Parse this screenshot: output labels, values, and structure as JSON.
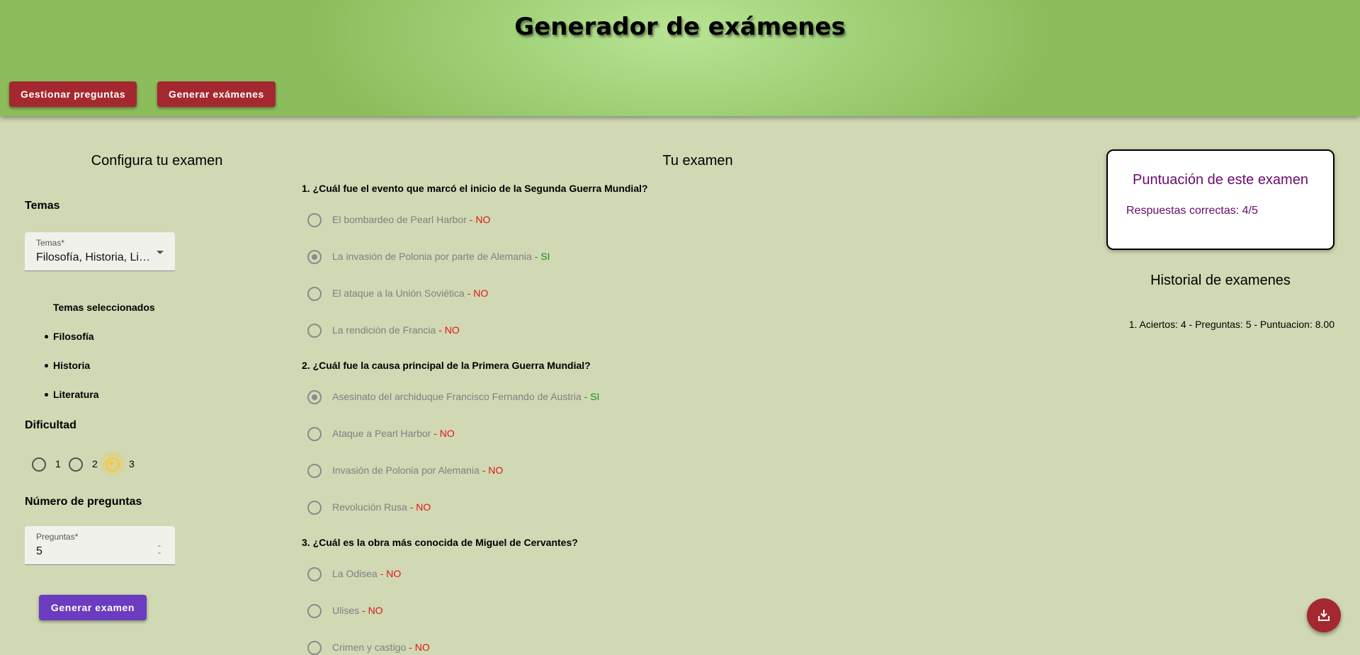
{
  "header": {
    "title": "Generador de exámenes",
    "nav": [
      "Gestionar preguntas",
      "Generar exámenes"
    ]
  },
  "config": {
    "title": "Configura tu examen",
    "topics_heading": "Temas",
    "topics_select": {
      "label": "Temas*",
      "value": "Filosofía, Historia, Li…"
    },
    "selected_heading": "Temas seleccionados",
    "selected_topics": [
      "Filosofía",
      "Historia",
      "Literatura"
    ],
    "difficulty_heading": "Dificultad",
    "difficulty_options": [
      "1",
      "2",
      "3"
    ],
    "difficulty_selected": "3",
    "questions_heading": "Número de preguntas",
    "questions_field": {
      "label": "Preguntas*",
      "value": "5"
    },
    "generate_label": "Generar examen"
  },
  "exam": {
    "title": "Tu examen",
    "questions": [
      {
        "text": "1. ¿Cuál fue el evento que marcó el inicio de la Segunda Guerra Mundial?",
        "options": [
          {
            "text": "El bombardeo de Pearl Harbor",
            "result": "- NO",
            "correct": false,
            "checked": false
          },
          {
            "text": "La invasión de Polonia por parte de Alemania",
            "result": "- SI",
            "correct": true,
            "checked": true
          },
          {
            "text": "El ataque a la Unión Soviética",
            "result": "- NO",
            "correct": false,
            "checked": false
          },
          {
            "text": "La rendición de Francia",
            "result": "- NO",
            "correct": false,
            "checked": false
          }
        ]
      },
      {
        "text": "2. ¿Cuál fue la causa principal de la Primera Guerra Mundial?",
        "options": [
          {
            "text": "Asesinato del archiduque Francisco Fernando de Austria",
            "result": "- SI",
            "correct": true,
            "checked": true
          },
          {
            "text": "Ataque a Pearl Harbor",
            "result": "- NO",
            "correct": false,
            "checked": false
          },
          {
            "text": "Invasión de Polonia por Alemania",
            "result": "- NO",
            "correct": false,
            "checked": false
          },
          {
            "text": "Revolución Rusa",
            "result": "- NO",
            "correct": false,
            "checked": false
          }
        ]
      },
      {
        "text": "3. ¿Cuál es la obra más conocida de Miguel de Cervantes?",
        "options": [
          {
            "text": "La Odisea",
            "result": "- NO",
            "correct": false,
            "checked": false
          },
          {
            "text": "Ulises",
            "result": "- NO",
            "correct": false,
            "checked": false
          },
          {
            "text": "Crimen y castigo",
            "result": "- NO",
            "correct": false,
            "checked": false
          }
        ]
      }
    ]
  },
  "score": {
    "title": "Puntuación de este examen",
    "text": "Respuestas correctas: 4/5"
  },
  "history": {
    "title": "Historial de examenes",
    "items": [
      "1. Aciertos: 4 - Preguntas: 5 - Puntuacion: 8.00"
    ]
  },
  "colors": {
    "header_green": "#a2d37a",
    "nav_red": "#a4282f",
    "generate_purple": "#6b3cc0",
    "score_purple": "#6a0a6f",
    "result_no": "#e01515",
    "result_si": "#1a8a1a",
    "difficulty_gold": "#f5c63a"
  },
  "icons": {
    "fab": "download-icon",
    "select": "chevron-down-icon",
    "stepper": "spin-arrows-icon"
  }
}
